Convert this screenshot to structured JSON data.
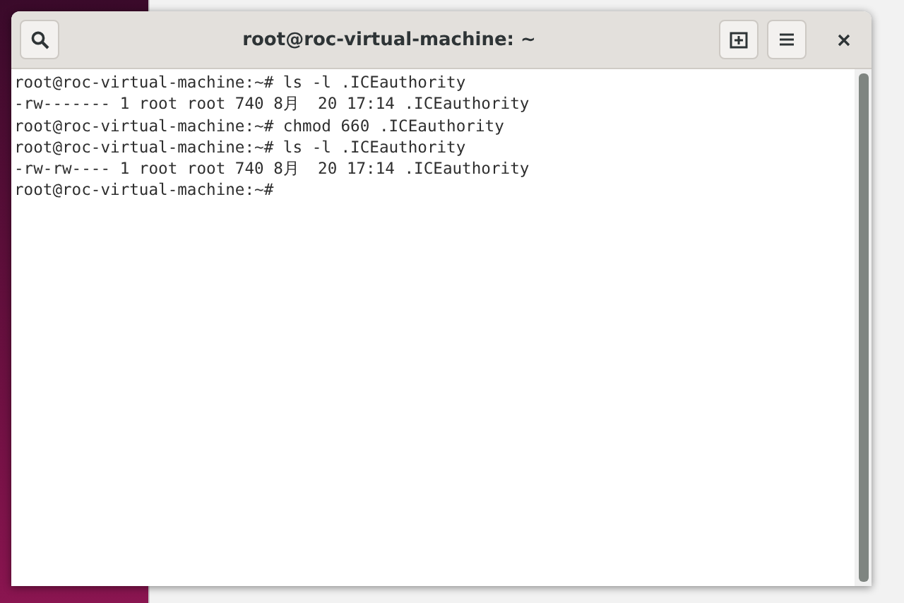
{
  "window": {
    "title": "root@roc-virtual-machine: ~"
  },
  "terminal": {
    "lines": [
      "root@roc-virtual-machine:~# ls -l .ICEauthority",
      "-rw------- 1 root root 740 8月  20 17:14 .ICEauthority",
      "root@roc-virtual-machine:~# chmod 660 .ICEauthority",
      "root@roc-virtual-machine:~# ls -l .ICEauthority",
      "-rw-rw---- 1 root root 740 8月  20 17:14 .ICEauthority",
      "root@roc-virtual-machine:~#"
    ]
  }
}
